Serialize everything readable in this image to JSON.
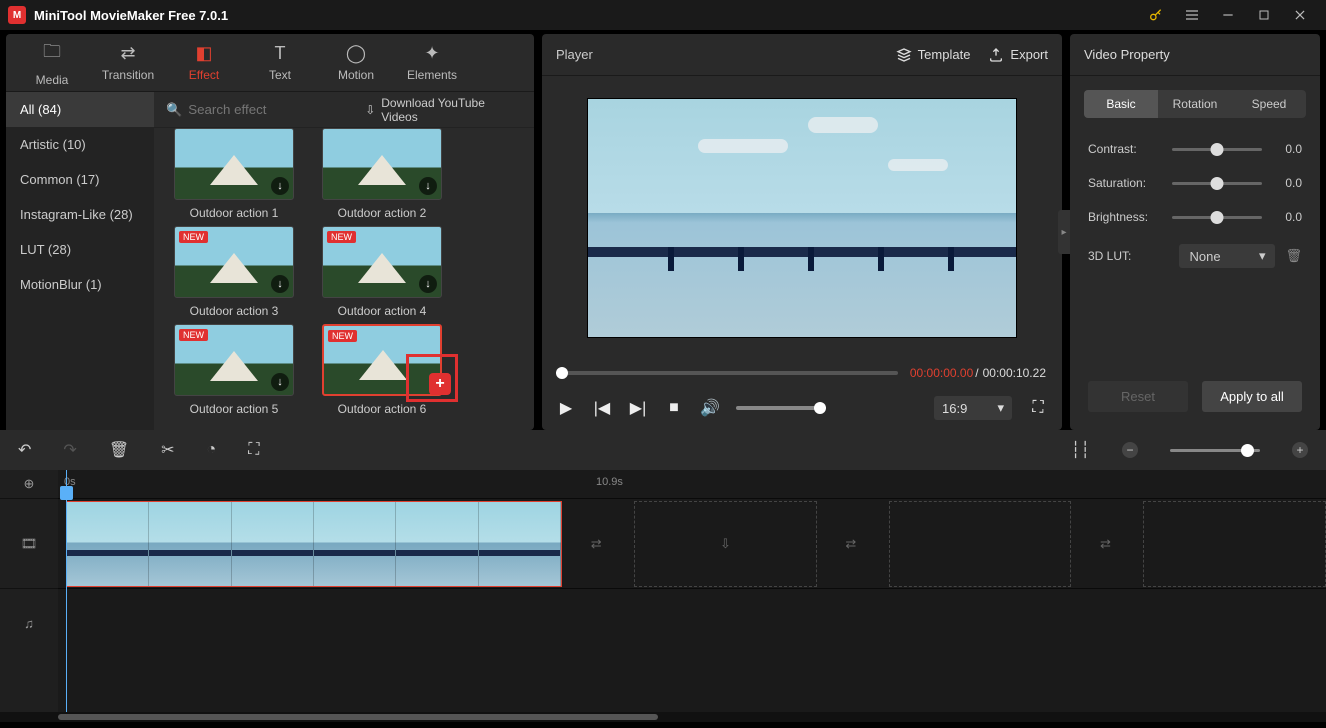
{
  "app": {
    "title": "MiniTool MovieMaker Free 7.0.1"
  },
  "topTabs": {
    "media": "Media",
    "transition": "Transition",
    "effect": "Effect",
    "text": "Text",
    "motion": "Motion",
    "elements": "Elements"
  },
  "categories": {
    "all": "All (84)",
    "artistic": "Artistic (10)",
    "common": "Common (17)",
    "instagram": "Instagram-Like (28)",
    "lut": "LUT (28)",
    "motionblur": "MotionBlur (1)"
  },
  "search": {
    "placeholder": "Search effect",
    "download": "Download YouTube Videos"
  },
  "effects": {
    "e1": "Outdoor action 1",
    "e2": "Outdoor action 2",
    "e3": "Outdoor action 3",
    "e4": "Outdoor action 4",
    "e5": "Outdoor action 5",
    "e6": "Outdoor action 6",
    "new": "NEW"
  },
  "player": {
    "title": "Player",
    "template": "Template",
    "export": "Export",
    "current": "00:00:00.00",
    "sep": "/",
    "total": "00:00:10.22",
    "ratio": "16:9"
  },
  "props": {
    "title": "Video Property",
    "tabs": {
      "basic": "Basic",
      "rotation": "Rotation",
      "speed": "Speed"
    },
    "contrast": {
      "label": "Contrast:",
      "value": "0.0"
    },
    "saturation": {
      "label": "Saturation:",
      "value": "0.0"
    },
    "brightness": {
      "label": "Brightness:",
      "value": "0.0"
    },
    "lut": {
      "label": "3D LUT:",
      "value": "None"
    },
    "reset": "Reset",
    "apply": "Apply to all"
  },
  "timeline": {
    "t0": "0s",
    "t1": "10.9s"
  }
}
